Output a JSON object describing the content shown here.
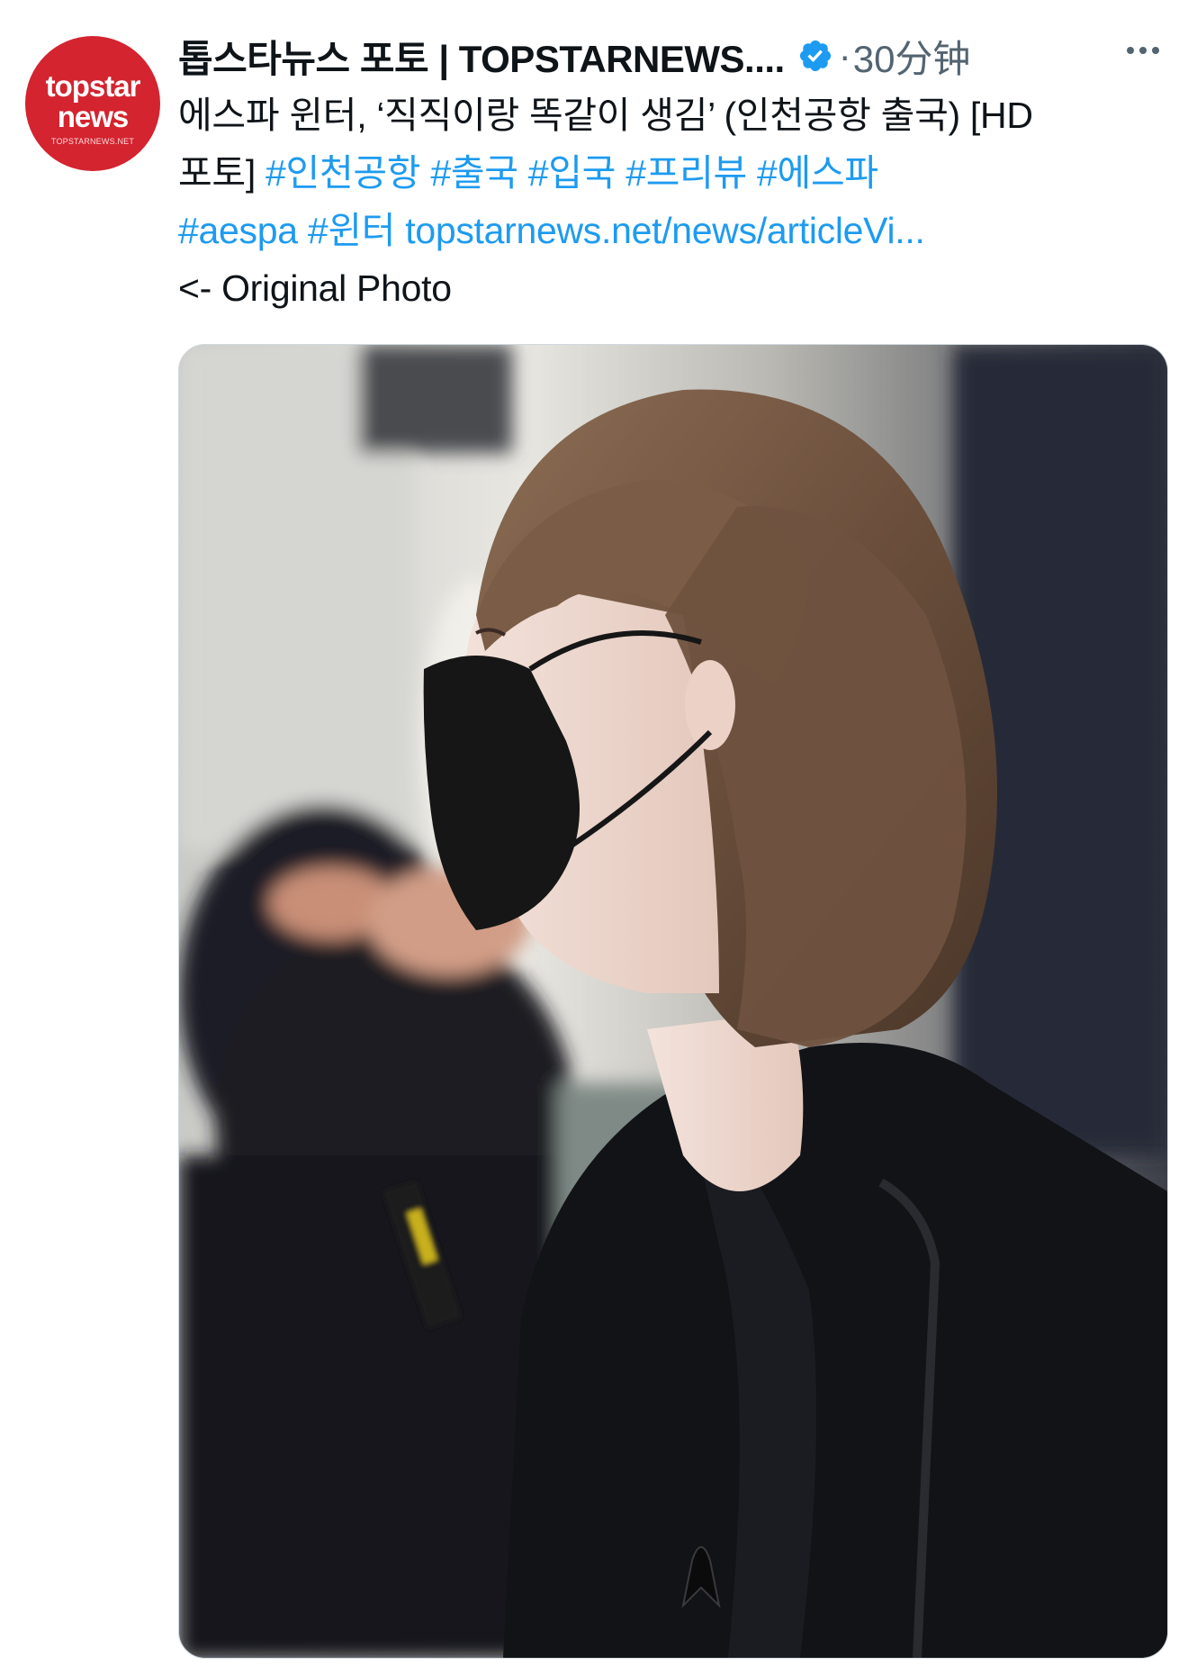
{
  "author": {
    "display_name": "톱스타뉴스 포토 | TOPSTARNEWS....",
    "verified": true,
    "avatar": {
      "logo_line1": "topstar",
      "logo_line2": "news",
      "logo_sub": "TOPSTARNEWS.NET",
      "bg_color": "#d32430"
    }
  },
  "meta": {
    "separator": "·",
    "timestamp": "30分钟",
    "more_icon": "more-horizontal-icon"
  },
  "tweet": {
    "line1": "에스파 윈터, ‘직직이랑 똑같이 생김’ (인천공항 출국) [HD",
    "line2_text": "포토]",
    "hashtags_line2": [
      "#인천공항",
      "#출국",
      "#입국",
      "#프리뷰",
      "#에스파"
    ],
    "hashtags_line3": [
      "#aespa",
      "#윈터"
    ],
    "link": "topstarnews.net/news/articleVi...",
    "line4": "<- Original Photo"
  },
  "colors": {
    "accent": "#1d9bf0",
    "text": "#0f1419",
    "muted": "#536471"
  }
}
